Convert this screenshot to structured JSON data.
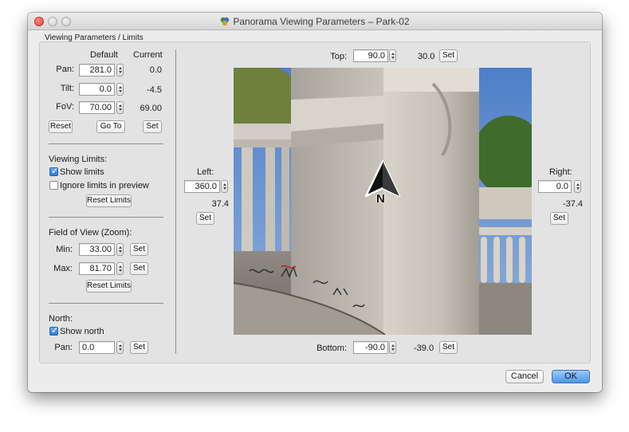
{
  "window": {
    "title": "Panorama Viewing Parameters – Park-02"
  },
  "group": {
    "label": "Viewing Parameters / Limits"
  },
  "params": {
    "header_default": "Default",
    "header_current": "Current",
    "pan": {
      "label": "Pan:",
      "value": "281.0",
      "current": "0.0"
    },
    "tilt": {
      "label": "Tilt:",
      "value": "0.0",
      "current": "-4.5"
    },
    "fov": {
      "label": "FoV:",
      "value": "70.00",
      "current": "69.00"
    },
    "reset_label": "Reset",
    "goto_label": "Go To",
    "set_label": "Set"
  },
  "viewing_limits": {
    "heading": "Viewing Limits:",
    "show_limits": "Show limits",
    "show_limits_checked": true,
    "ignore_limits": "Ignore limits in preview",
    "ignore_limits_checked": false,
    "reset_label": "Reset Limits"
  },
  "field_of_view": {
    "heading": "Field of View (Zoom):",
    "min_label": "Min:",
    "min_value": "33.00",
    "max_label": "Max:",
    "max_value": "81.70",
    "set_label": "Set",
    "reset_label": "Reset Limits"
  },
  "north": {
    "heading": "North:",
    "show_north": "Show north",
    "show_north_checked": true,
    "pan_label": "Pan:",
    "pan_value": "0.0",
    "set_label": "Set",
    "marker": "N"
  },
  "limits": {
    "top": {
      "label": "Top:",
      "value": "90.0",
      "current": "30.0"
    },
    "bottom": {
      "label": "Bottom:",
      "value": "-90.0",
      "current": "-39.0"
    },
    "left": {
      "label": "Left:",
      "value": "360.0",
      "current": "37.4"
    },
    "right": {
      "label": "Right:",
      "value": "0.0",
      "current": "-37.4"
    },
    "set_label": "Set"
  },
  "footer": {
    "cancel_label": "Cancel",
    "ok_label": "OK"
  }
}
